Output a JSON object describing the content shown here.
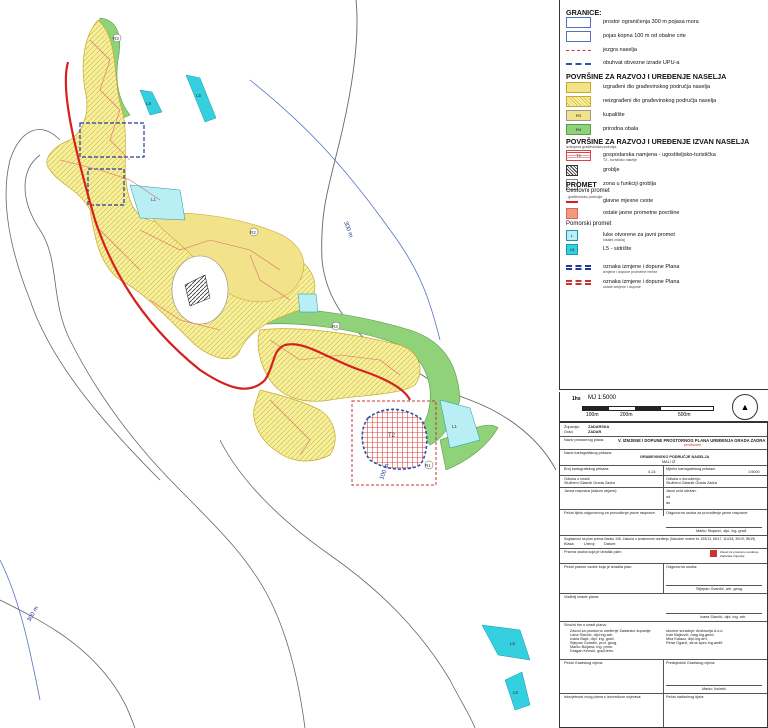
{
  "map": {
    "label_300m_east": "300 m",
    "label_300m_west": "300 m",
    "label_100m": "100 m",
    "zone_labels": {
      "r1": "R1",
      "r2": "R2",
      "r3": "R3",
      "l1": "L1",
      "l5": "L5",
      "t2": "T2"
    }
  },
  "legend": {
    "granice_title": "GRANICE:",
    "granice": [
      {
        "label": "prostor ograničenja 300 m pojasa mora"
      },
      {
        "label": "pojas kopna 100 m od obalne crte"
      },
      {
        "label": "jezgra naselja"
      },
      {
        "label": "obuhvat obvezne izrade UPU-a"
      }
    ],
    "naselja_title": "POVRŠINE ZA RAZVOJ I UREĐENJE NASELJA",
    "naselja": [
      {
        "label": "izgrađeni dio građevinskog područja naselja"
      },
      {
        "label": "neizgrađeni dio građevinskog područja naselja"
      },
      {
        "label": "kupalište",
        "code": "R3"
      },
      {
        "label": "prirodna obala",
        "code": "R4"
      }
    ],
    "izvan_title": "POVRŠINE ZA RAZVOJ I UREĐENJE IZVAN NASELJA",
    "izvan_subtitle": "izdvojena građevinska područja",
    "izvan": [
      {
        "label": "gospodarska namjena - ugostiteljsko-turistička",
        "sub": "T2 - turističko naselje",
        "code": "T2"
      },
      {
        "label": "groblje"
      },
      {
        "label": "zona u funkciji groblja"
      }
    ],
    "promet_title": "PROMET",
    "cestovni": "Cestovni promet",
    "cestovni_sub": "- građevinsko područje",
    "promet": [
      {
        "label": "glavne mjesne ceste"
      },
      {
        "label": "ostale javne prometne površine"
      }
    ],
    "pomorski": "Pomorski promet",
    "pomorski_items": [
      {
        "label": "luke otvorene za javni promet",
        "sub": "lokalni značaj",
        "code": "L"
      },
      {
        "label": "L5 - sidrište",
        "code": "L5"
      }
    ],
    "izmjene": [
      {
        "label": "oznaka izmjene i dopune Plana",
        "sub": "izmjene i dopune prometne mreže"
      },
      {
        "label": "oznaka izmjene i dopune Plana",
        "sub": "ostale izmjene i dopune"
      }
    ]
  },
  "scale": {
    "ratio": "MJ 1:5000",
    "n": "1hs",
    "ticks": [
      "100m",
      "200m",
      "500m"
    ]
  },
  "title_block": {
    "zupanija_label": "Županija:",
    "zupanija": "ZADARSKA",
    "grad_label": "Grad:",
    "grad": "ZADAR",
    "plan_label": "Naziv prostornog plana:",
    "plan": "V. IZMJENE I DOPUNE PROSTORNOG PLANA UREĐENJA GRADA ZADRA",
    "plan_sub": "pročišćeni",
    "kartografski_label": "Naziv kartografskog prikaza:",
    "kartografski": "GRAĐEVINSKO PODRUČJE NASELJA",
    "kartografski_sub": "MALI IŽ",
    "broj_label": "Broj kartografskog prikaza:",
    "broj": "4.13.",
    "mjerilo_label": "Mjerilo kartografskog prikaza:",
    "mjerilo": "1:5000",
    "odluka_label": "Odluka o izradi:",
    "odluka": "Službeni Glasnik Grada Zadra",
    "odluka2_label": "Odluka o donošenju:",
    "odluka2": "Službeni Glasnik Grada Zadra",
    "javna_label": "Javna rasprava (datum objave):",
    "javni_uvid_label": "Javni uvid održan:",
    "od": "od",
    "do": "do",
    "pecat_label": "Pečat tijela odgovornog za provođenje javne rasprave:",
    "odgovorna_label": "Odgovorna osoba za provođenje javne rasprave:",
    "odgovorna_name": "Marko Stojanić, dipl. ing. građ.",
    "suglasnost": "Suglasnost na plan prema članku 108. Zakona o prostornom uređenju (Narodne novine br. 153/13, 65/17, 114/18, 39/19, 98/19)",
    "klasa": "Klasa:",
    "urbroj": "Urbroj:",
    "datum": "Datum:",
    "izradivac_label": "Pravna osoba koja je izradila plan:",
    "izradivac_logo_txt": "Zavod za prostorno uređenje Zadarske županije",
    "pecat2_label": "Pečat pravne osobe koja je izradila plan:",
    "odg_osoba_label": "Odgovorna osoba:",
    "odg_osoba_name": "Slijepan Gvardić, arh. geog.",
    "voditelj_label": "Voditelj izrade plana:",
    "voditelj_name": "Ivana Slavčić, dipl. ing. arh.",
    "tim_label": "Stručni tim u izradi plana:",
    "tim": [
      "Zavod za prostorno uređenje Zadarske županije",
      "Lana Slavčić, dipl.ing.arh.",
      "Ivana Bajić, dipl. ing. građ.",
      "Stjepan Gvardić, prof. geog.",
      "Marko Buljana, ing. prom.",
      "Dragan Krinski, građ.tehn."
    ],
    "tim2": [
      "stručne suradnje: Ambrozija d.o.o.",
      "Ivan Bajković, mag.ing.geod.",
      "Mira Kalauz, dipl.ing.arh.",
      "Petar Ogarić, struč.spec.ing.aedif."
    ],
    "pecat3_label": "Pečat Gradskog vijeća:",
    "predsjednik_label": "Predsjednik Gradskog vijeća:",
    "predsjednik_name": "Marko Vučetić",
    "istovjetnost_label": "Istovjetnost ovog plana s izvornikom ovjerava:",
    "pecat4_label": "Pečat nadležnog tijela:"
  }
}
